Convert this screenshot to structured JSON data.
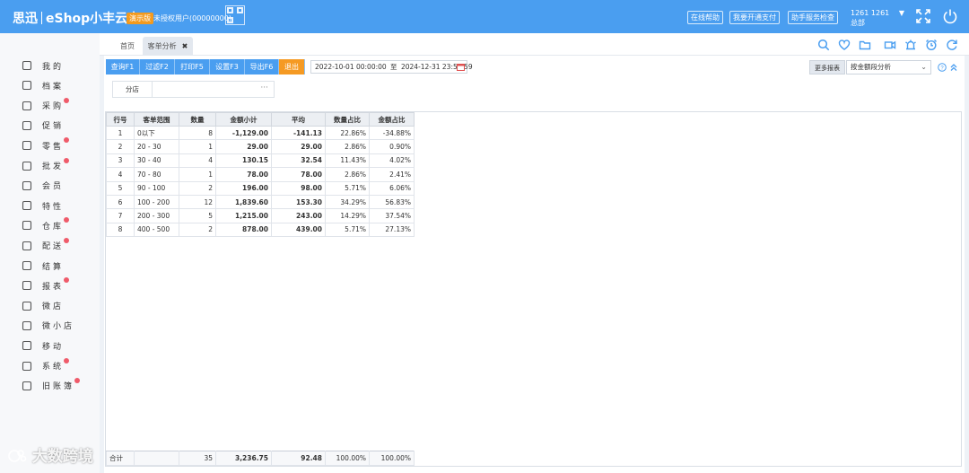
{
  "header": {
    "brand": "思迅",
    "product": "eShop小丰云商6",
    "demo_badge": "演示版",
    "user_info": "未授权用户(00000000)",
    "buttons": [
      "在线帮助",
      "我要开通支付",
      "助手服务检查"
    ],
    "account": "1261 1261",
    "branch": "总部",
    "account_caret": "▼"
  },
  "sidebar": {
    "items": [
      {
        "label": "我的",
        "icon": "user-icon",
        "dot": false
      },
      {
        "label": "档案",
        "icon": "archive-icon",
        "dot": false
      },
      {
        "label": "采购",
        "icon": "purchase-icon",
        "dot": true
      },
      {
        "label": "促销",
        "icon": "promotion-icon",
        "dot": false
      },
      {
        "label": "零售",
        "icon": "retail-bag-icon",
        "dot": true
      },
      {
        "label": "批发",
        "icon": "wholesale-icon",
        "dot": true
      },
      {
        "label": "会员",
        "icon": "member-icon",
        "dot": false
      },
      {
        "label": "特性",
        "icon": "feature-icon",
        "dot": false
      },
      {
        "label": "仓库",
        "icon": "warehouse-icon",
        "dot": true
      },
      {
        "label": "配送",
        "icon": "delivery-icon",
        "dot": true
      },
      {
        "label": "结算",
        "icon": "settlement-icon",
        "dot": false
      },
      {
        "label": "报表",
        "icon": "report-icon",
        "dot": true
      },
      {
        "label": "微店",
        "icon": "micro-store-icon",
        "dot": false
      },
      {
        "label": "微小店",
        "icon": "mini-store-icon",
        "dot": false
      },
      {
        "label": "移动",
        "icon": "mobile-icon",
        "dot": false
      },
      {
        "label": "系统",
        "icon": "system-gear-icon",
        "dot": true
      },
      {
        "label": "旧账簿",
        "icon": "ledger-icon",
        "dot": true
      }
    ]
  },
  "tabs": [
    {
      "label": "首页",
      "active": false
    },
    {
      "label": "客单分析",
      "active": true,
      "close": "✖"
    }
  ],
  "toolbar": {
    "buttons": [
      "查询F1",
      "过滤F2",
      "打印F5",
      "设置F3",
      "导出F6",
      "退出"
    ],
    "date_from": "2022-10-01 00:00:00",
    "date_sep": "至",
    "date_to": "2024-12-31 23:59:59",
    "more_reports": "更多报表",
    "report_select": "按金额段分析",
    "caret": "⌄"
  },
  "filter": {
    "label": "分店",
    "more": "···"
  },
  "table": {
    "columns": [
      "行号",
      "客单范围",
      "数量",
      "金额小计",
      "平均",
      "数量占比",
      "金额占比"
    ],
    "rows": [
      [
        "1",
        "0以下",
        "8",
        "-1,129.00",
        "-141.13",
        "22.86%",
        "-34.88%"
      ],
      [
        "2",
        "20 - 30",
        "1",
        "29.00",
        "29.00",
        "2.86%",
        "0.90%"
      ],
      [
        "3",
        "30 - 40",
        "4",
        "130.15",
        "32.54",
        "11.43%",
        "4.02%"
      ],
      [
        "4",
        "70 - 80",
        "1",
        "78.00",
        "78.00",
        "2.86%",
        "2.41%"
      ],
      [
        "5",
        "90 - 100",
        "2",
        "196.00",
        "98.00",
        "5.71%",
        "6.06%"
      ],
      [
        "6",
        "100 - 200",
        "12",
        "1,839.60",
        "153.30",
        "34.29%",
        "56.83%"
      ],
      [
        "7",
        "200 - 300",
        "5",
        "1,215.00",
        "243.00",
        "14.29%",
        "37.54%"
      ],
      [
        "8",
        "400 - 500",
        "2",
        "878.00",
        "439.00",
        "5.71%",
        "27.13%"
      ]
    ],
    "total": [
      "合计",
      "",
      "35",
      "3,236.75",
      "92.48",
      "100.00%",
      "100.00%"
    ]
  },
  "watermark": "大数跨境",
  "colors": {
    "primary": "#4a9ef0",
    "exit": "#f59a23",
    "badge": "#f39a1e",
    "dot": "#ef5b6a"
  }
}
